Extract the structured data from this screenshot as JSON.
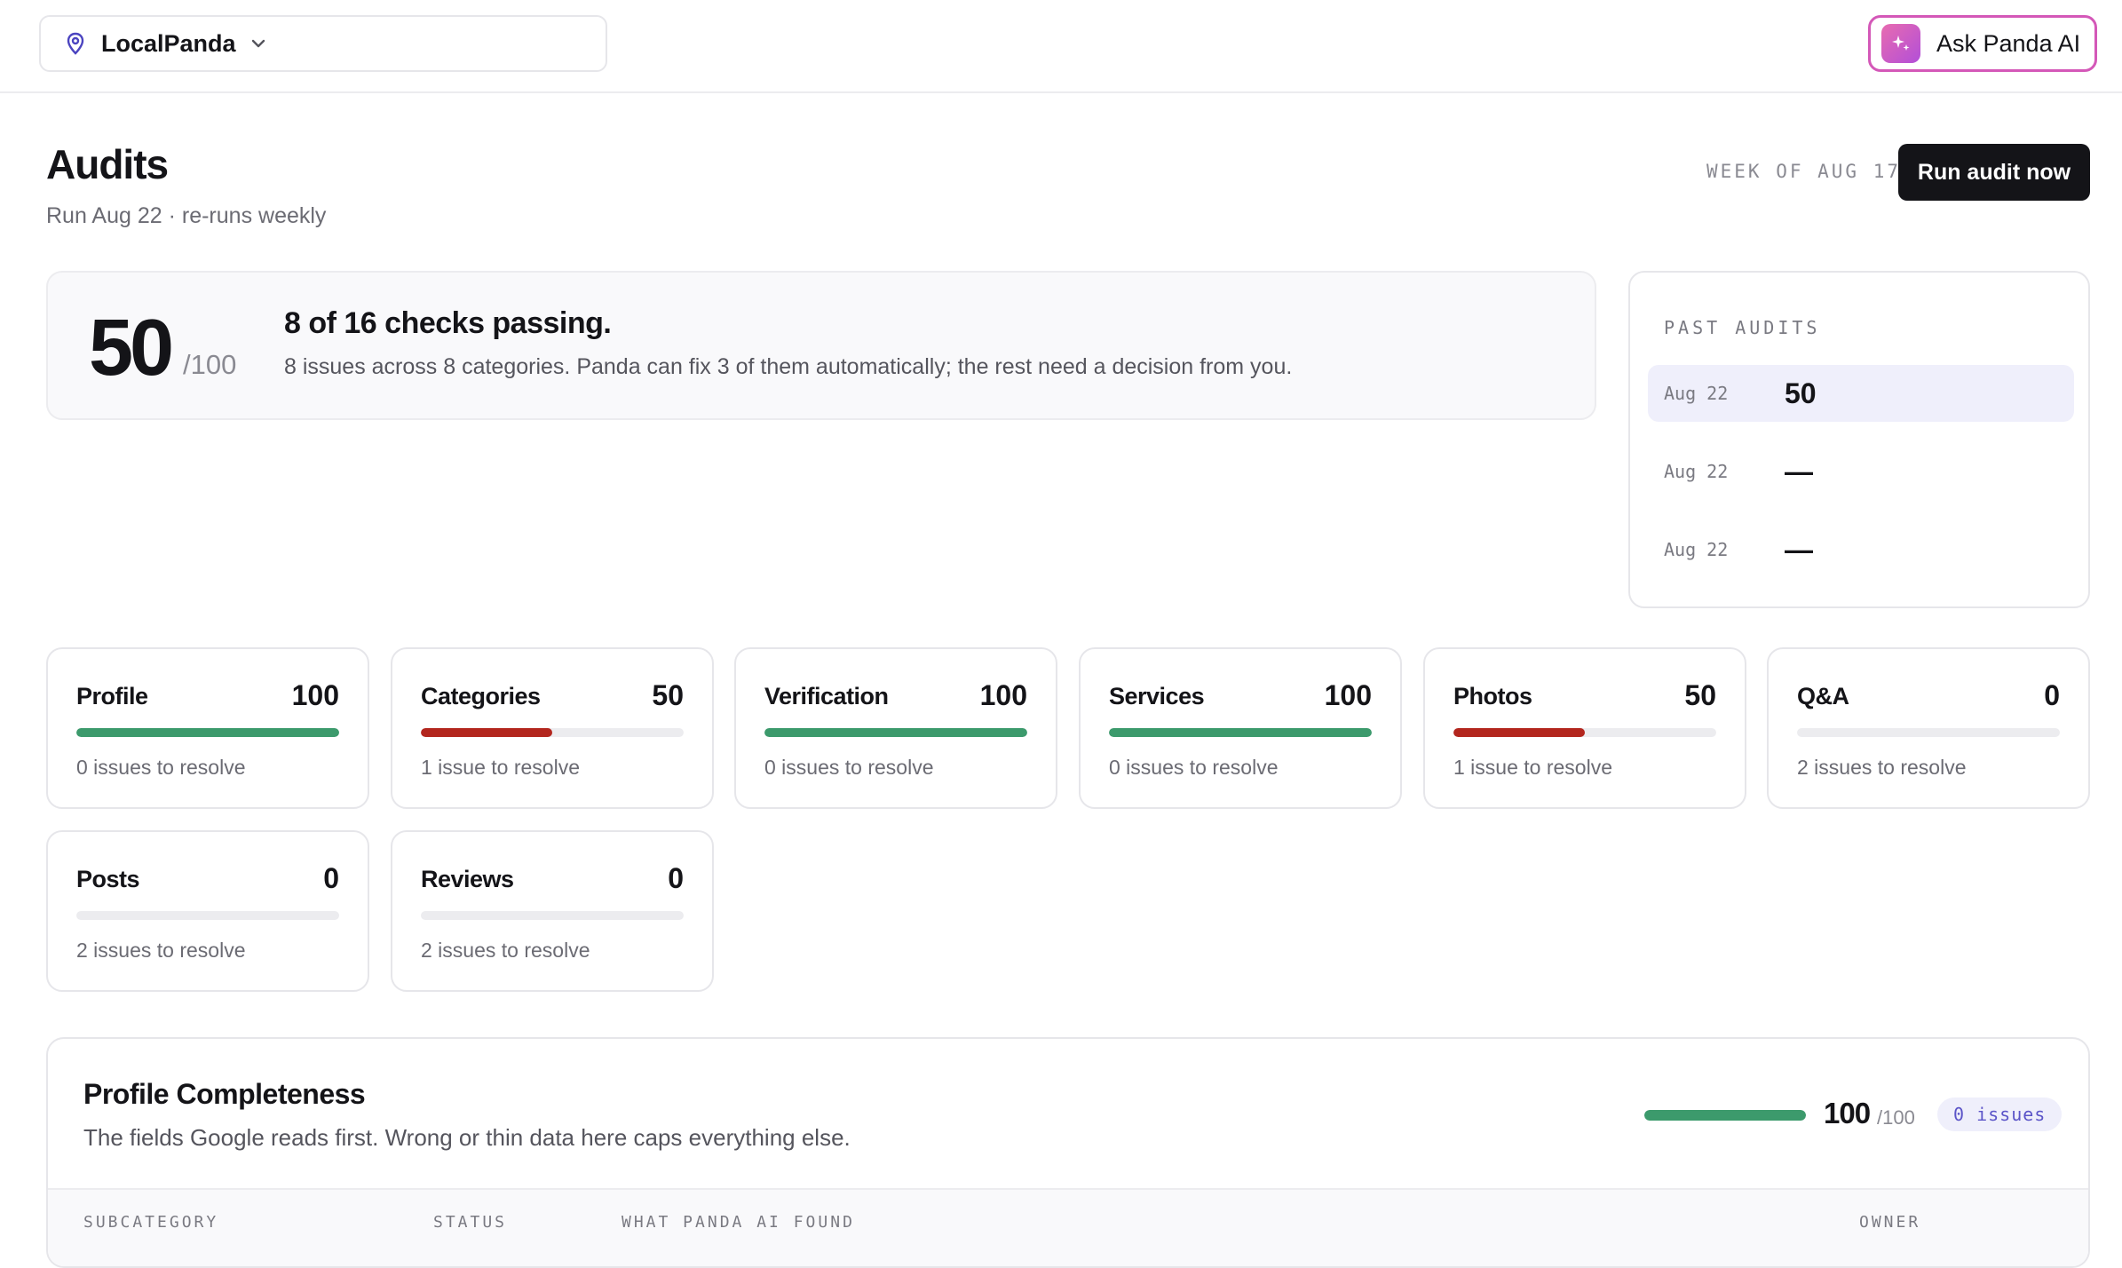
{
  "topbar": {
    "location": "LocalPanda",
    "ask_label": "Ask Panda AI"
  },
  "header": {
    "title": "Audits",
    "subtitle": "Run Aug 22 · re-runs weekly",
    "week": "WEEK OF AUG 17",
    "run_label": "Run audit now"
  },
  "score": {
    "value": "50",
    "out_of": "/100",
    "headline": "8 of 16 checks passing.",
    "description": "8 issues across 8 categories. Panda can fix 3 of them automatically; the rest need a decision from you."
  },
  "past_audits": {
    "title": "PAST AUDITS",
    "rows": [
      {
        "date": "Aug 22",
        "value": "50"
      },
      {
        "date": "Aug 22",
        "value": "—"
      },
      {
        "date": "Aug 22",
        "value": "—"
      }
    ]
  },
  "categories": [
    {
      "name": "Profile",
      "score": "100",
      "progress": 1.0,
      "color": "#3c9a6c",
      "issues": "0 issues to resolve"
    },
    {
      "name": "Categories",
      "score": "50",
      "progress": 0.5,
      "color": "#b3261e",
      "issues": "1 issue to resolve"
    },
    {
      "name": "Verification",
      "score": "100",
      "progress": 1.0,
      "color": "#3c9a6c",
      "issues": "0 issues to resolve"
    },
    {
      "name": "Services",
      "score": "100",
      "progress": 1.0,
      "color": "#3c9a6c",
      "issues": "0 issues to resolve"
    },
    {
      "name": "Photos",
      "score": "50",
      "progress": 0.5,
      "color": "#b3261e",
      "issues": "1 issue to resolve"
    },
    {
      "name": "Q&A",
      "score": "0",
      "progress": 0,
      "color": "#3c9a6c",
      "issues": "2 issues to resolve"
    },
    {
      "name": "Posts",
      "score": "0",
      "progress": 0,
      "color": "#3c9a6c",
      "issues": "2 issues to resolve"
    },
    {
      "name": "Reviews",
      "score": "0",
      "progress": 0,
      "color": "#3c9a6c",
      "issues": "2 issues to resolve"
    }
  ],
  "profile_completeness": {
    "title": "Profile Completeness",
    "description": "The fields Google reads first. Wrong or thin data here caps everything else.",
    "score": "100",
    "out_of": "/100",
    "progress": 1.0,
    "badge": "0 issues",
    "columns": [
      "SUBCATEGORY",
      "STATUS",
      "WHAT PANDA AI FOUND",
      "OWNER"
    ]
  },
  "colors": {
    "good": "#3c9a6c",
    "bad": "#b3261e",
    "accent": "#d458b8"
  }
}
